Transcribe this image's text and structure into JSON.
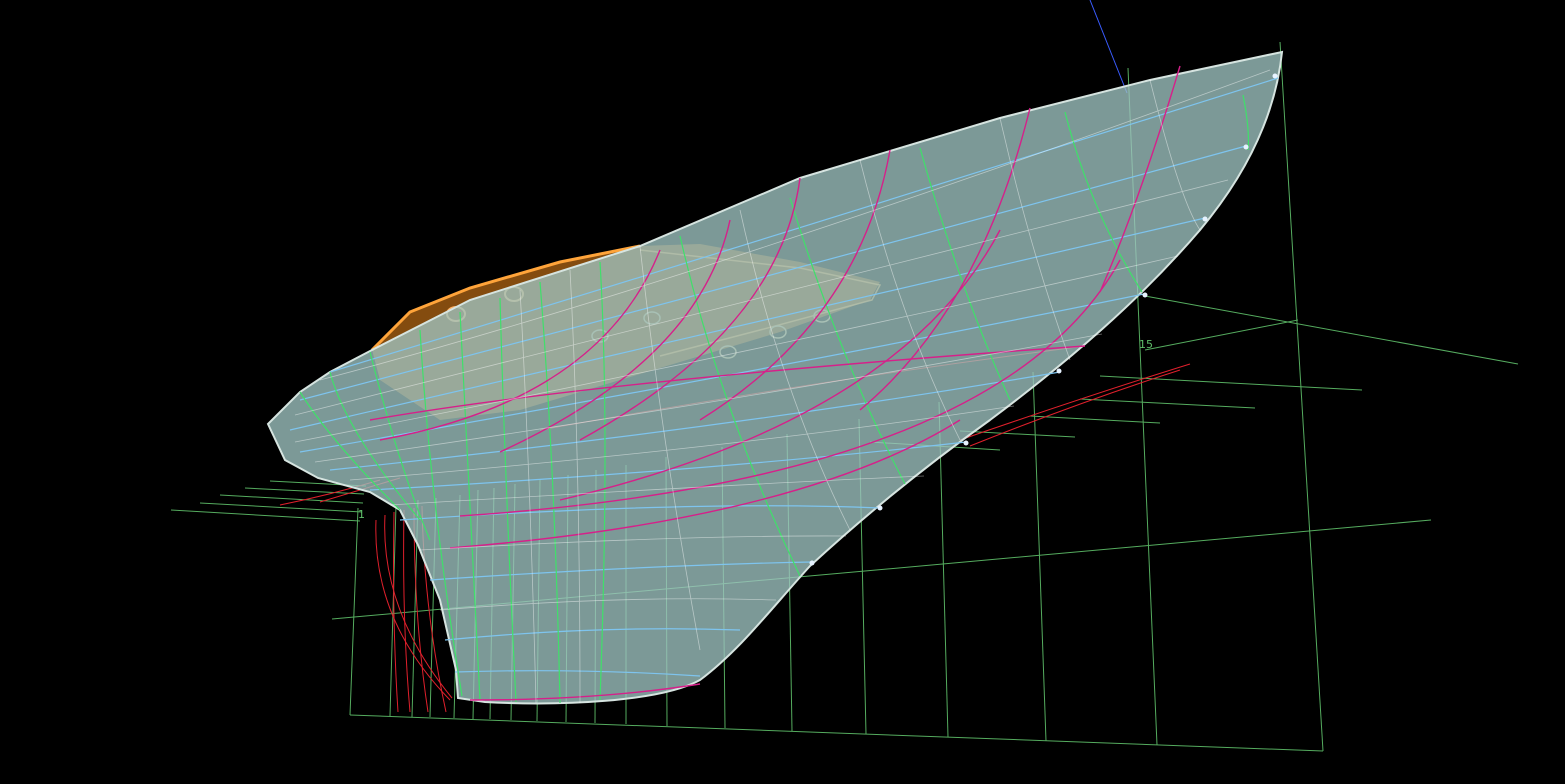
{
  "viewport": {
    "background": "#000000"
  },
  "labels": {
    "station_15": "15",
    "station_1": "1"
  },
  "colors": {
    "grid": "#5fbf6a",
    "hull_fill": "#9fc4c2",
    "hull_edge": "#d6e4e0",
    "waterline": "#7ec4ee",
    "station": "#3fe06a",
    "buttock": "#d6208a",
    "section_red": "#e0202c",
    "deck": "#f08a1c",
    "axis_blue": "#3a5cff",
    "control_point": "#e6f2ff"
  }
}
